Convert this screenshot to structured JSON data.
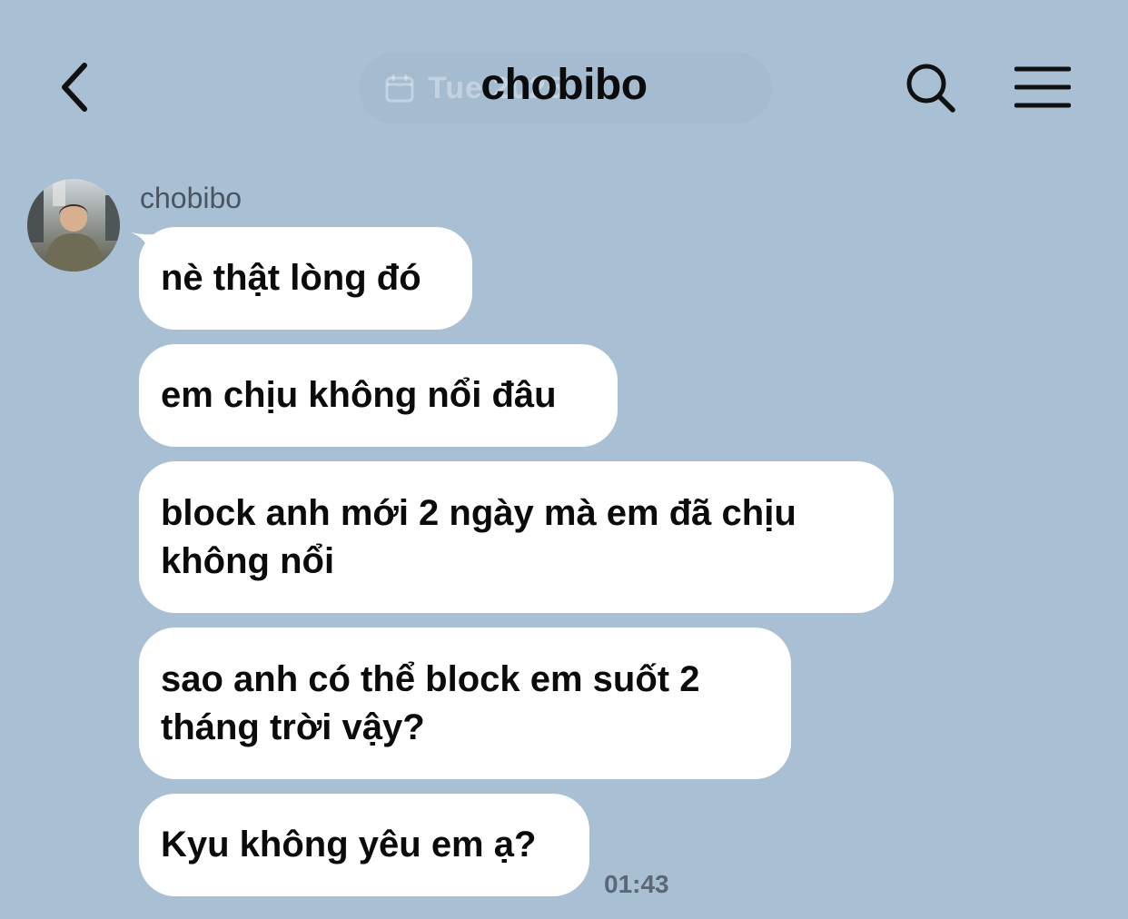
{
  "header": {
    "title": "chobibo",
    "date_label": "Tue 2025",
    "back_icon": "chevron-left-icon",
    "search_icon": "search-icon",
    "menu_icon": "hamburger-menu-icon"
  },
  "conversation": {
    "sender": "chobibo",
    "messages": [
      {
        "text": "nè thật lòng đó"
      },
      {
        "text": "em chịu không nổi đâu"
      },
      {
        "text": "block anh mới 2 ngày mà em đã chịu không nổi"
      },
      {
        "text": "sao anh có thể block em suốt 2 tháng trời vậy?"
      },
      {
        "text": "Kyu không yêu em ạ?"
      }
    ],
    "last_timestamp": "01:43"
  },
  "colors": {
    "background": "#a9bfd3",
    "bubble": "#ffffff",
    "text": "#0b0b0b"
  }
}
